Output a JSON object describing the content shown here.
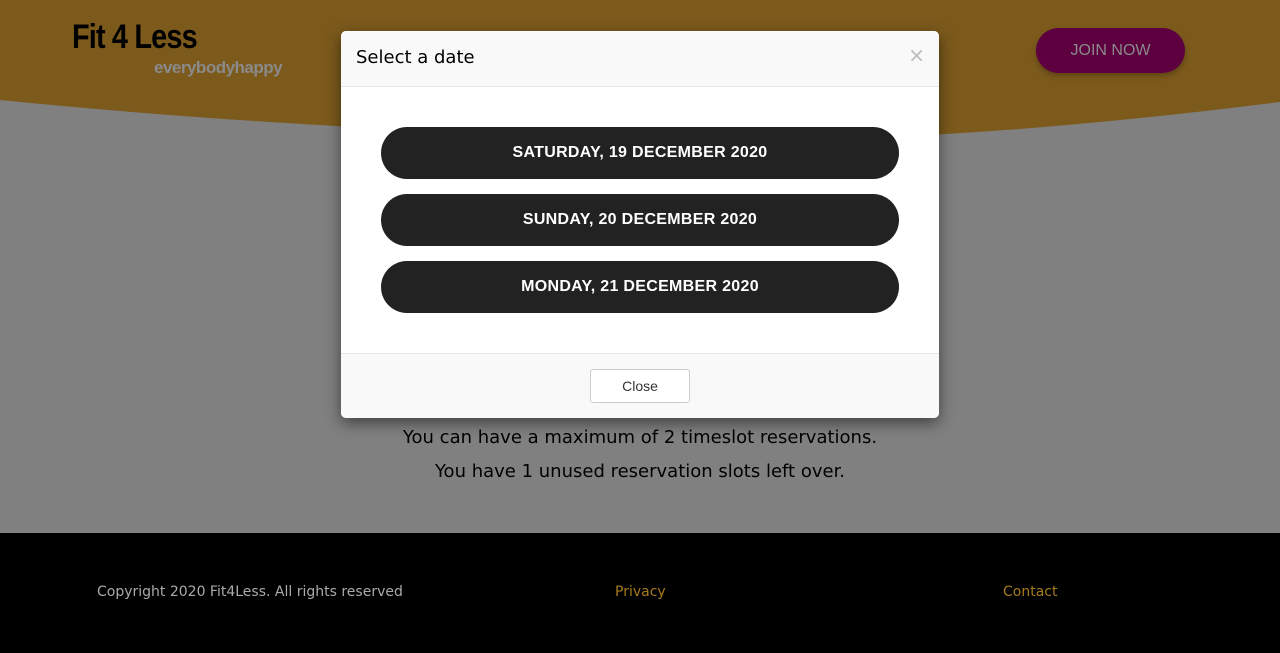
{
  "header": {
    "logo": "Fit 4 Less",
    "tagline": "everybodyhappy",
    "join_label": "JOIN NOW"
  },
  "info": {
    "line1": "You can have a maximum of 2 timeslot reservations.",
    "line2": "You have 1 unused reservation slots left over."
  },
  "modal": {
    "title": "Select a date",
    "close_icon": "×",
    "dates": [
      "SATURDAY, 19 DECEMBER 2020",
      "SUNDAY, 20 DECEMBER 2020",
      "MONDAY, 21 DECEMBER 2020"
    ],
    "close_label": "Close"
  },
  "footer": {
    "copyright": "Copyright 2020 Fit4Less. All rights reserved",
    "privacy": "Privacy",
    "contact": "Contact"
  },
  "colors": {
    "header": "#7c5a1c",
    "join": "#5e0040",
    "link": "#a67a1e"
  }
}
